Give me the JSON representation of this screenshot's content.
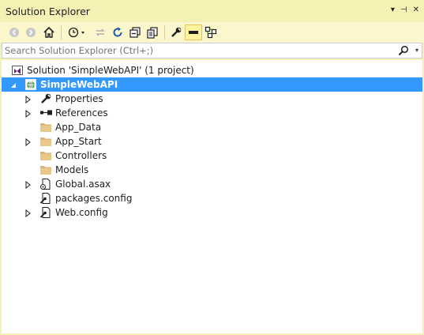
{
  "window": {
    "title": "Solution Explorer",
    "controls": [
      "▾",
      "⊣",
      "✕"
    ]
  },
  "toolbar": {
    "buttons": [
      "back-icon",
      "forward-icon",
      "home-icon",
      "pending-changes-icon",
      "sync-icon",
      "refresh-icon",
      "collapse-all-icon",
      "show-all-files-icon",
      "properties-icon",
      "preview-selected-icon",
      "view-class-diagram-icon"
    ]
  },
  "search": {
    "placeholder": "Search Solution Explorer (Ctrl+;)"
  },
  "tree": {
    "solution_label": "Solution 'SimpleWebAPI' (1 project)",
    "project_label": "SimpleWebAPI",
    "items": [
      {
        "label": "Properties",
        "expandable": true,
        "icon": "wrench-icon"
      },
      {
        "label": "References",
        "expandable": true,
        "icon": "references-icon"
      },
      {
        "label": "App_Data",
        "expandable": false,
        "icon": "folder-icon"
      },
      {
        "label": "App_Start",
        "expandable": true,
        "icon": "folder-icon"
      },
      {
        "label": "Controllers",
        "expandable": false,
        "icon": "folder-icon"
      },
      {
        "label": "Models",
        "expandable": false,
        "icon": "folder-icon"
      },
      {
        "label": "Global.asax",
        "expandable": true,
        "icon": "asax-file-icon"
      },
      {
        "label": "packages.config",
        "expandable": false,
        "icon": "config-file-icon"
      },
      {
        "label": "Web.config",
        "expandable": true,
        "icon": "config-file-icon"
      }
    ]
  },
  "colors": {
    "chrome": "#f5f0b4",
    "selection": "#3399ff"
  }
}
